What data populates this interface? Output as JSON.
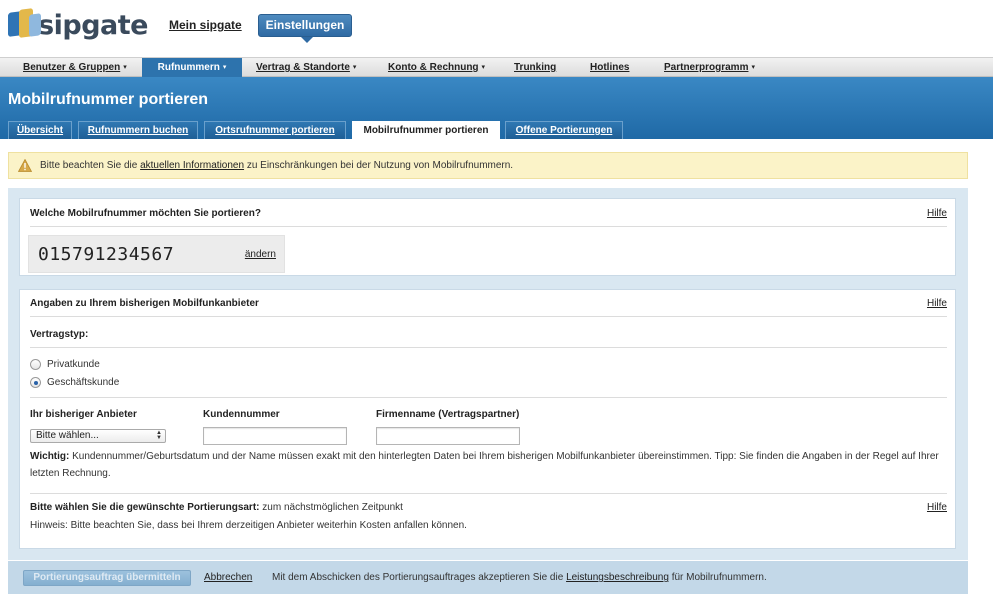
{
  "brand": {
    "name": "sipgate",
    "colors": {
      "primary": "#2d73ad",
      "band": "#1f69a6",
      "alert_bg": "#fbf3c8"
    }
  },
  "header": {
    "link_label": "Mein sipgate",
    "active_button_label": "Einstellungen"
  },
  "mainnav": {
    "items": [
      {
        "label": "Benutzer & Gruppen",
        "caret": "▾"
      },
      {
        "label": "Rufnummern",
        "caret": "▾"
      },
      {
        "label": "Vertrag & Standorte",
        "caret": "▾"
      },
      {
        "label": "Konto & Rechnung",
        "caret": "▾"
      },
      {
        "label": "Trunking"
      },
      {
        "label": "Hotlines"
      },
      {
        "label": "Partnerprogramm",
        "caret": "▾"
      }
    ],
    "active_index": 1
  },
  "page": {
    "title": "Mobilrufnummer portieren",
    "subtabs": [
      {
        "label": "Übersicht"
      },
      {
        "label": "Rufnummern buchen"
      },
      {
        "label": "Ortsrufnummer portieren"
      },
      {
        "label": "Mobilrufnummer portieren"
      },
      {
        "label": "Offene Portierungen"
      }
    ],
    "active_subtab_index": 3
  },
  "alert": {
    "icon": "warning-icon",
    "text_before": "Bitte beachten Sie die",
    "link": "aktuellen Informationen",
    "text_after": "zu Einschränkungen bei der Nutzung von Mobilrufnummern."
  },
  "number_card": {
    "title": "Welche Mobilrufnummer möchten Sie portieren?",
    "help_label": "Hilfe",
    "number": "015791234567",
    "change_label": "ändern"
  },
  "provider_card": {
    "title": "Angaben zu Ihrem bisherigen Mobilfunkanbieter",
    "help_label": "Hilfe",
    "contract_type_label": "Vertragstyp:",
    "radio_options": [
      {
        "label": "Privatkunde",
        "checked": false
      },
      {
        "label": "Geschäftskunde",
        "checked": true
      }
    ],
    "provider_label": "Ihr bisheriger Anbieter",
    "provider_select_value": "Bitte wählen...",
    "customer_number_label": "Kundennummer",
    "customer_number_value": "",
    "company_label": "Firmenname (Vertragspartner)",
    "company_value": "",
    "important_label": "Wichtig:",
    "important_text": "Kundennummer/Geburtsdatum und der Name müssen exakt mit den hinterlegten Daten bei Ihrem bisherigen Mobilfunkanbieter übereinstimmen. Tipp: Sie finden die Angaben in der Regel auf Ihrer letzten Rechnung.",
    "porting_type_label": "Bitte wählen Sie die gewünschte Portierungsart:",
    "porting_type_value": "zum nächstmöglichen Zeitpunkt",
    "porting_help_label": "Hilfe",
    "porting_note": "Hinweis: Bitte beachten Sie, dass bei Ihrem derzeitigen Anbieter weiterhin Kosten anfallen können."
  },
  "footer": {
    "submit_label": "Portierungsauftrag übermitteln",
    "cancel_label": "Abbrechen",
    "note_before": "Mit dem Abschicken des Portierungsauftrages akzeptieren Sie die",
    "note_link": "Leistungsbeschreibung",
    "note_after": "für Mobilrufnummern."
  }
}
